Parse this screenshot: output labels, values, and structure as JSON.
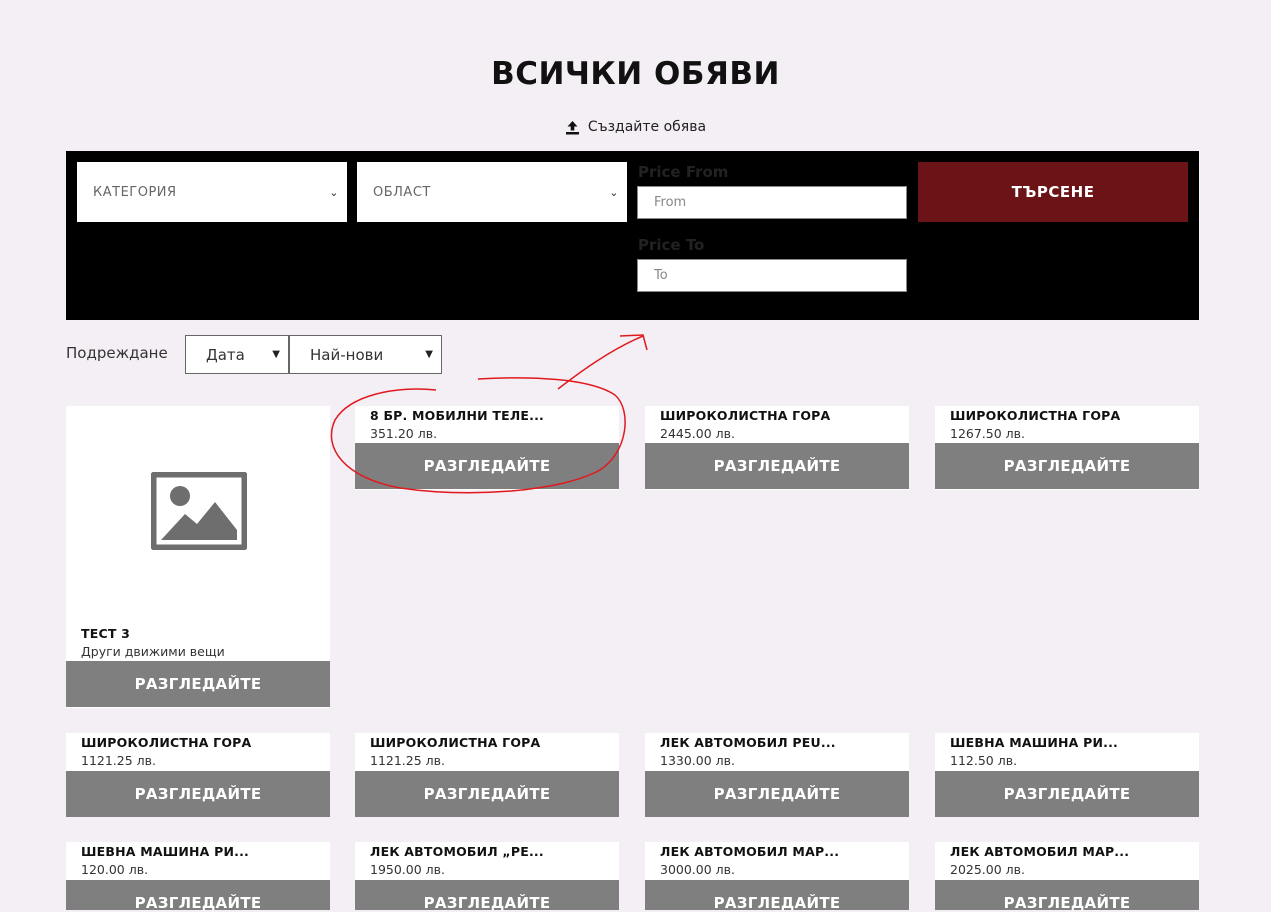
{
  "page_title": "ВСИЧКИ ОБЯВИ",
  "create_link": {
    "label": "Създайте обява",
    "icon": "upload-icon"
  },
  "filters": {
    "category_placeholder": "КАТЕГОРИЯ",
    "region_placeholder": "ОБЛАСТ",
    "price_from_label": "Price From",
    "price_from_placeholder": "From",
    "price_to_label": "Price To",
    "price_to_placeholder": "To",
    "search_label": "ТЪРСЕНЕ"
  },
  "sort": {
    "label": "Подреждане",
    "field": "Дата",
    "order": "Най-нови"
  },
  "listings": [
    {
      "title": "ТЕСТ 3",
      "subtitle": "Други движими вещи",
      "button": "РАЗГЛЕДАЙТЕ",
      "has_image": true
    },
    {
      "title": "8 БР. МОБИЛНИ ТЕЛЕ...",
      "subtitle": "351.20 лв.",
      "button": "РАЗГЛЕДАЙТЕ"
    },
    {
      "title": "ШИРОКОЛИСТНА ГОРА",
      "subtitle": "2445.00 лв.",
      "button": "РАЗГЛЕДАЙТЕ"
    },
    {
      "title": "ШИРОКОЛИСТНА ГОРА",
      "subtitle": "1267.50 лв.",
      "button": "РАЗГЛЕДАЙТЕ"
    },
    {
      "title": "ШИРОКОЛИСТНА ГОРА",
      "subtitle": "1121.25 лв.",
      "button": "РАЗГЛЕДАЙТЕ"
    },
    {
      "title": "ШИРОКОЛИСТНА ГОРА",
      "subtitle": "1121.25 лв.",
      "button": "РАЗГЛЕДАЙТЕ"
    },
    {
      "title": "ЛЕК АВТОМОБИЛ PEU...",
      "subtitle": "1330.00 лв.",
      "button": "РАЗГЛЕДАЙТЕ"
    },
    {
      "title": "ШЕВНА МАШИНА РИ...",
      "subtitle": "112.50 лв.",
      "button": "РАЗГЛЕДАЙТЕ"
    },
    {
      "title": "ШЕВНА МАШИНА РИ...",
      "subtitle": "120.00 лв.",
      "button": "РАЗГЛЕДАЙТЕ"
    },
    {
      "title": "ЛЕК АВТОМОБИЛ „РЕ...",
      "subtitle": "1950.00 лв.",
      "button": "РАЗГЛЕДАЙТЕ"
    },
    {
      "title": "ЛЕК АВТОМОБИЛ МАР...",
      "subtitle": "3000.00 лв.",
      "button": "РАЗГЛЕДАЙТЕ"
    },
    {
      "title": "ЛЕК АВТОМОБИЛ МАР...",
      "subtitle": "2025.00 лв.",
      "button": "РАЗГЛЕДАЙТЕ"
    }
  ],
  "colors": {
    "background": "#f4eff4",
    "filter_bar": "#000000",
    "search_button": "#6b1316",
    "card_button": "#7f7f7f",
    "annotation": "#e0191f"
  }
}
